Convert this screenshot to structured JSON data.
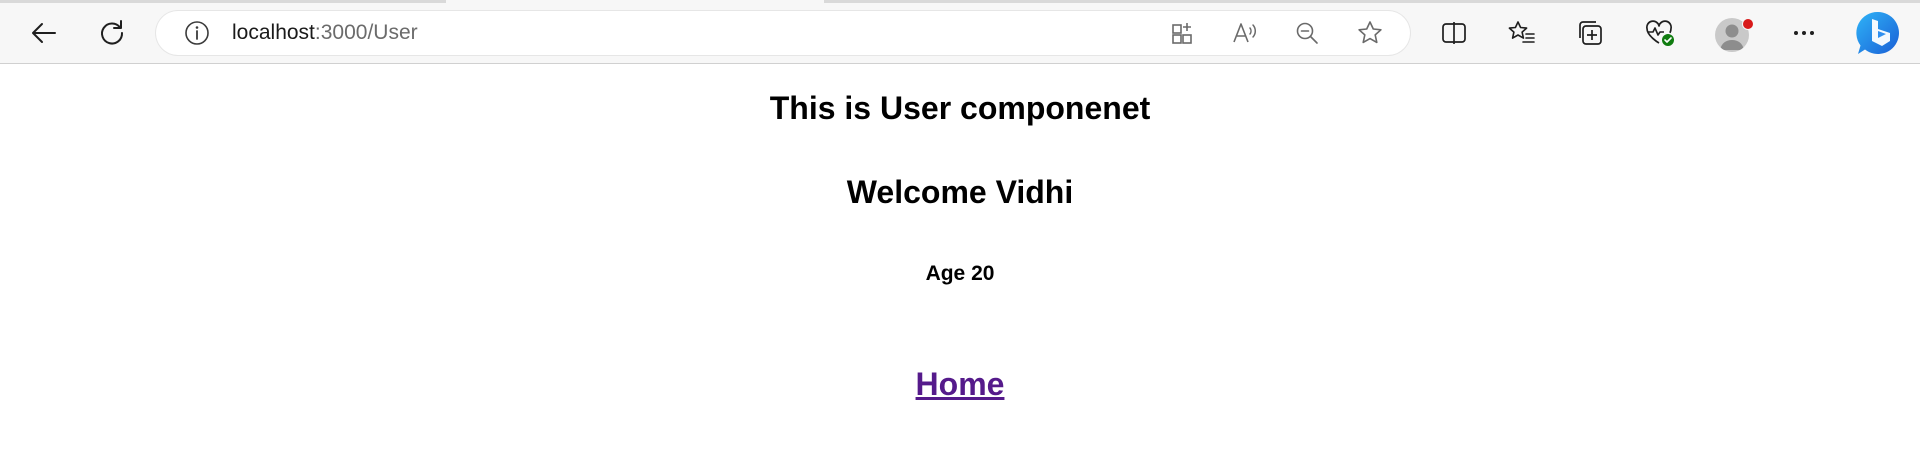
{
  "browser": {
    "address_bar": {
      "host": "localhost",
      "path": ":3000/User"
    },
    "icons": {
      "back": "arrow-left",
      "refresh": "refresh",
      "site_info": "info",
      "apps": "grid-plus",
      "read_aloud": "read-aloud",
      "zoom_out": "zoom-out",
      "favorite": "star",
      "split_screen": "split-screen",
      "favorites": "star-list",
      "collections": "collections",
      "performance": "heart-pulse-check",
      "profile": "avatar",
      "more": "ellipsis",
      "copilot": "bing-copilot"
    },
    "colors": {
      "toolbar_bg": "#f7f7f7",
      "profile_badge": "#d81919",
      "performance_check": "#107c10",
      "copilot_blue": "#1a73e8"
    }
  },
  "page": {
    "title": "This is User componenet",
    "welcome": "Welcome Vidhi",
    "age": "Age 20",
    "home_link": "Home",
    "link_color": "#551a8b"
  }
}
